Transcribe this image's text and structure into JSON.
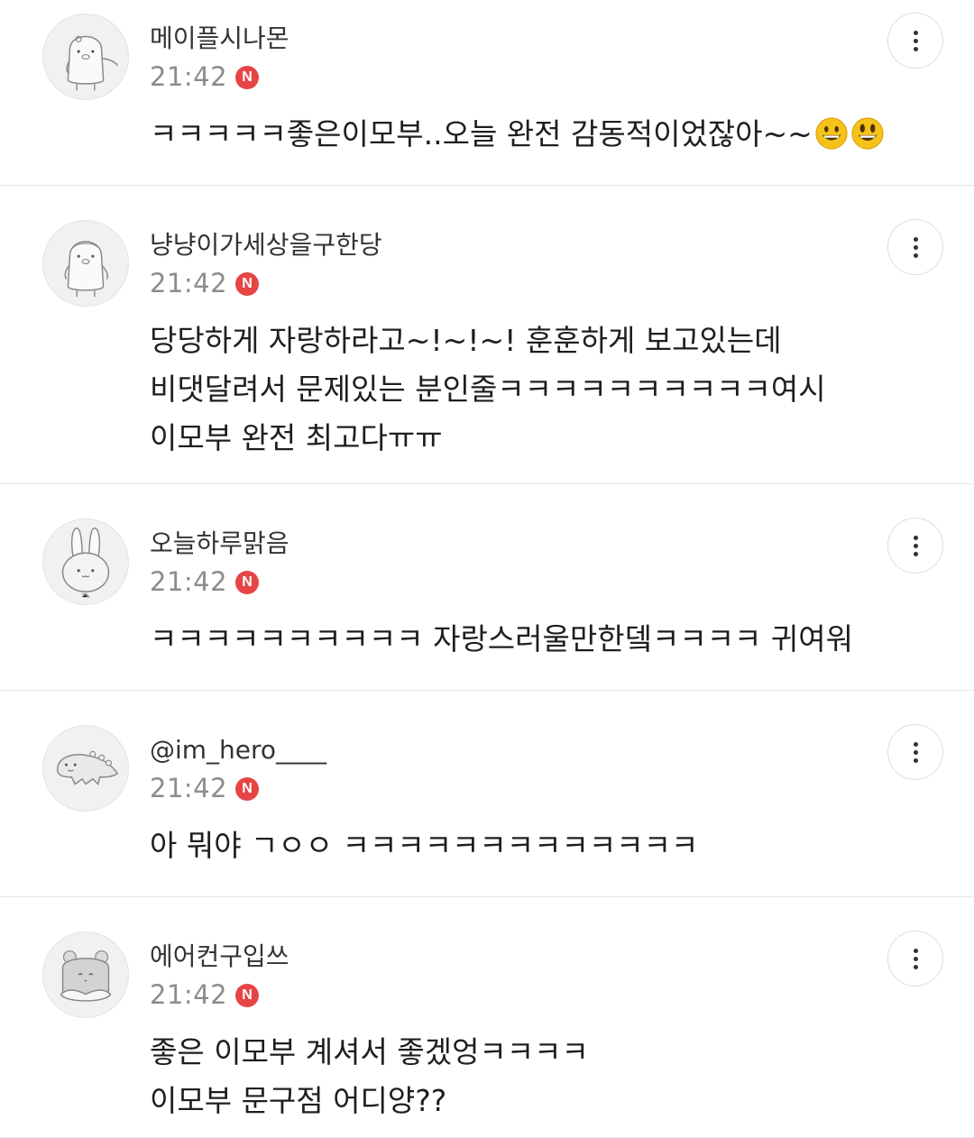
{
  "comments": [
    {
      "nickname": "메이플시나몬",
      "time": "21:42",
      "badge": "N",
      "lines": [
        "ㅋㅋㅋㅋㅋ좋은이모부..오늘 완전 감동적이었잖아~~"
      ],
      "emoji": [
        "grinning-face",
        "grinning-face-big-eyes"
      ],
      "avatar_icon": "penguin-character-icon"
    },
    {
      "nickname": "냥냥이가세상을구한당",
      "time": "21:42",
      "badge": "N",
      "lines": [
        "당당하게 자랑하라고~!~!~! 훈훈하게 보고있는데",
        "비댓달려서 문제있는 분인줄ㅋㅋㅋㅋㅋㅋㅋㅋㅋㅋ여시",
        "이모부 완전 최고다ㅠㅠ"
      ],
      "avatar_icon": "penguin-character-icon"
    },
    {
      "nickname": "오늘하루맑음",
      "time": "21:42",
      "badge": "N",
      "lines": [
        "ㅋㅋㅋㅋㅋㅋㅋㅋㅋㅋ 자랑스러울만한뎈ㅋㅋㅋㅋ 귀여워"
      ],
      "avatar_icon": "rabbit-character-icon"
    },
    {
      "nickname": "@im_hero____",
      "time": "21:42",
      "badge": "N",
      "lines": [
        "아 뭐야 ㄱㅇㅇ ㅋㅋㅋㅋㅋㅋㅋㅋㅋㅋㅋㅋㅋ"
      ],
      "avatar_icon": "dinosaur-character-icon"
    },
    {
      "nickname": "에어컨구입쓰",
      "time": "21:42",
      "badge": "N",
      "lines": [
        "좋은 이모부 계셔서 좋겠엉ㅋㅋㅋㅋ",
        "이모부 문구점 어디양??"
      ],
      "avatar_icon": "hamster-character-icon"
    }
  ],
  "colors": {
    "badge": "#e64545",
    "time": "#8c8c8c",
    "divider": "#e6e6e6"
  },
  "more_icon": "vertical-ellipsis-icon"
}
